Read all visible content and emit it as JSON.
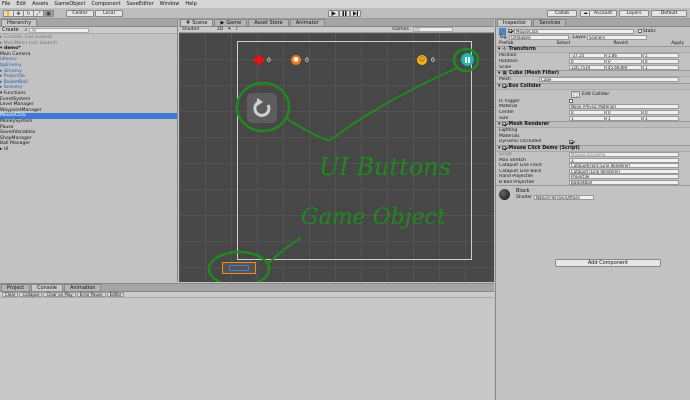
{
  "menu": [
    "File",
    "Edit",
    "Assets",
    "GameObject",
    "Component",
    "SaveEditor",
    "Window",
    "Help"
  ],
  "toolbar": {
    "pivot_label": "Center",
    "space_label": "Local",
    "collab_label": "Collab",
    "account_label": "Account",
    "layers_label": "Layers",
    "layout_label": "Default"
  },
  "hierarchy": {
    "tab_label": "Hierarchy",
    "create_label": "Create",
    "search_placeholder": "All",
    "rows": [
      {
        "text": "▸ Controls (not loaded)",
        "style": "gray"
      },
      {
        "text": "▸ MainMenu (not loaded)",
        "style": "gray"
      },
      {
        "text": "▾ demo*",
        "style": "bold"
      },
      {
        "text": "      Main Camera",
        "style": ""
      },
      {
        "text": "      Idleenv",
        "style": "blue"
      },
      {
        "text": "      bgEnemy",
        "style": "blue"
      },
      {
        "text": "   ▸ sEnemy",
        "style": "blue"
      },
      {
        "text": "   ▸ Projectile",
        "style": "blue"
      },
      {
        "text": "   ▸ BasketBall",
        "style": "blue"
      },
      {
        "text": "   ▸ Scenery",
        "style": "blue"
      },
      {
        "text": "   ▾ Functions",
        "style": ""
      },
      {
        "text": "         EventSystem",
        "style": ""
      },
      {
        "text": "         Level Manager",
        "style": ""
      },
      {
        "text": "         WaypointManager",
        "style": ""
      },
      {
        "text": "         MouseClick",
        "style": "selected"
      },
      {
        "text": "         MoneySystem",
        "style": ""
      },
      {
        "text": "         Pause",
        "style": ""
      },
      {
        "text": "         SavedVariables",
        "style": ""
      },
      {
        "text": "         ShopManager",
        "style": ""
      },
      {
        "text": "         Ball Manager",
        "style": ""
      },
      {
        "text": "   ▸ UI",
        "style": ""
      }
    ]
  },
  "scene": {
    "tabs": [
      "Scene",
      "Game",
      "Asset Store",
      "Animator"
    ],
    "shading": "Shaded",
    "mode": "2D",
    "gizmos": "Gizmos",
    "search": "All",
    "hud": {
      "health": "0",
      "coins": "0",
      "score": "0"
    },
    "annotations": {
      "ui_buttons": "UI Buttons",
      "game_object": "Game Object"
    }
  },
  "inspector": {
    "tabs": [
      "Inspector",
      "Services"
    ],
    "object_name": "MouseClick",
    "static_label": "Static",
    "tag_label": "Tag",
    "tag_value": "Untagged",
    "layer_label": "Layer",
    "layer_value": "Scenery",
    "prefab_buttons": [
      "Prefab",
      "Select",
      "Revert",
      "Apply"
    ],
    "transform": {
      "header": "Transform",
      "position": {
        "label": "Position",
        "x": "-37.14",
        "y": "1.86",
        "z": "1"
      },
      "rotation": {
        "label": "Rotation",
        "x": "0",
        "y": "0",
        "z": "0"
      },
      "scale": {
        "label": "Scale",
        "x": "126.7519",
        "y": "45.69369",
        "z": "1"
      }
    },
    "mesh_filter": {
      "header": "Cube (Mesh Filter)",
      "mesh_label": "Mesh",
      "mesh_value": "Cube"
    },
    "box_collider": {
      "header": "Box Collider",
      "edit_label": "Edit Collider",
      "is_trigger": "Is Trigger",
      "material_label": "Material",
      "material_value": "None (Physic Material)",
      "center_label": "Center",
      "center": [
        "0",
        "0",
        "0"
      ],
      "size_label": "Size",
      "size": [
        "1",
        "1",
        "1"
      ]
    },
    "mesh_renderer": {
      "header": "Mesh Renderer",
      "lighting": "Lighting",
      "materials": "Materials",
      "dynamic_occluded": "Dynamic Occluded"
    },
    "script": {
      "header": "Mouse Click Demo (Script)",
      "script_label": "Script",
      "script_value": "MouseClickDemo",
      "max_stretch_label": "Max Stretch",
      "max_stretch_value": "3",
      "catapult_front_label": "Catapult Line Front",
      "catapult_front_value": "CatapultFront (Line Renderer)",
      "catapult_back_label": "Catapult Line Back",
      "catapult_back_value": "Catapult (Line Renderer)",
      "hand_projectile_label": "Hand Projectile",
      "hand_projectile_value": "Projectile",
      "ball_projectile_label": "B Ball Projectile",
      "ball_projectile_value": "BasketBall"
    },
    "material": {
      "name": "Black",
      "shader_label": "Shader",
      "shader_value": "Nature/Terrain/Diffuse"
    },
    "add_component": "Add Component"
  },
  "console": {
    "tabs": [
      "Project",
      "Console",
      "Animation"
    ],
    "buttons": [
      "Clear",
      "Collapse",
      "Clear on Play",
      "Error Pause",
      "Editor"
    ]
  },
  "colors": {
    "selection": "#3d7ad6",
    "annotation_green": "#1f8a1f",
    "viewport": "#474747"
  }
}
